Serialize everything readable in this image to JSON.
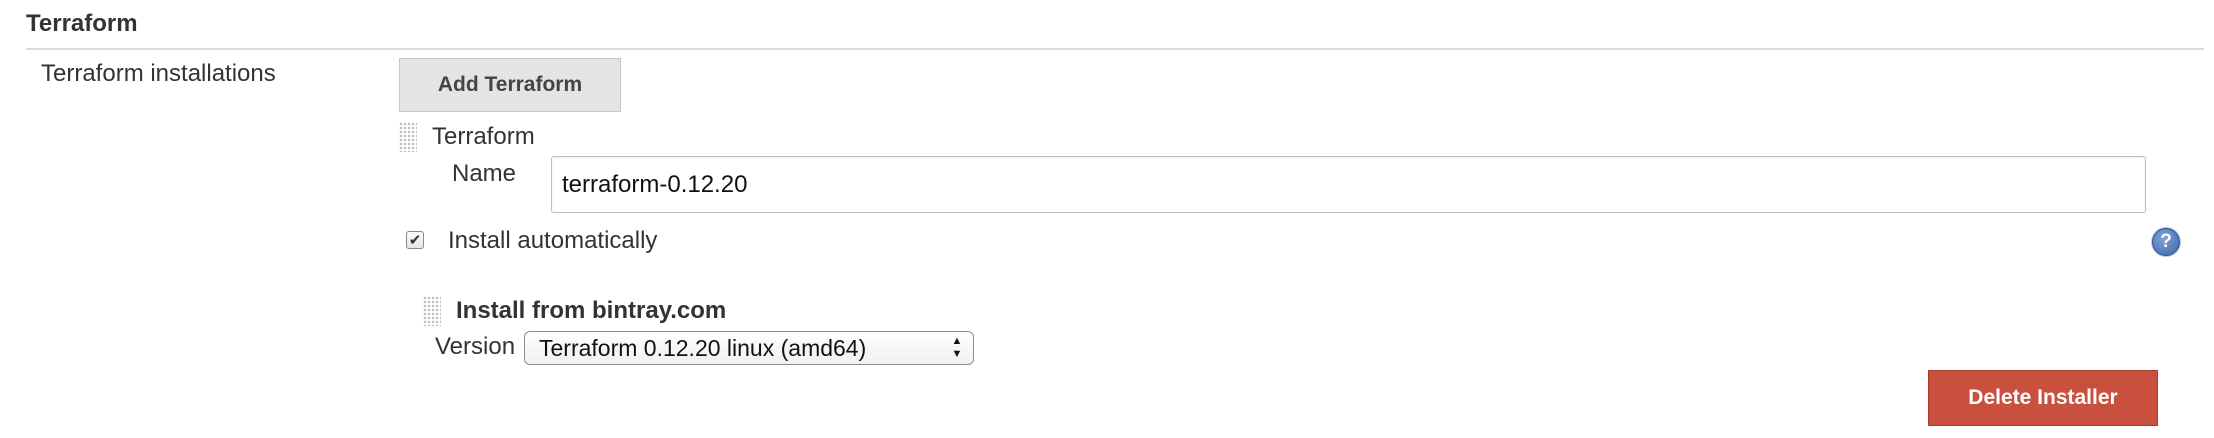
{
  "section": {
    "title": "Terraform"
  },
  "installations": {
    "label": "Terraform installations",
    "add_button_label": "Add Terraform",
    "tool": {
      "title": "Terraform",
      "name_label": "Name",
      "name_value": "terraform-0.12.20",
      "install_automatically_label": "Install automatically",
      "install_automatically_checked": true,
      "help_icon": "question-circle-icon",
      "installer": {
        "title": "Install from bintray.com",
        "version_label": "Version",
        "version_selected": "Terraform 0.12.20 linux (amd64)",
        "delete_button_label": "Delete Installer"
      }
    }
  },
  "colors": {
    "delete_button": "#c9503f",
    "add_button": "#e4e4e4",
    "help_icon": "#3a66a8"
  }
}
